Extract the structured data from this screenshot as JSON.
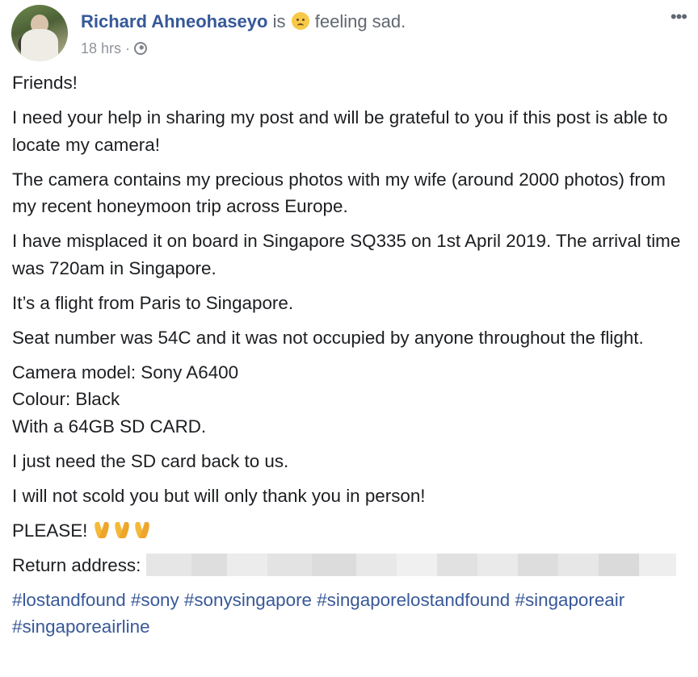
{
  "post": {
    "author": "Richard Ahneohaseyo",
    "is_word": "is",
    "feeling_emoji": "sad-face-emoji",
    "feeling_text": "feeling sad.",
    "time": "18 hrs",
    "separator": "·",
    "privacy_icon": "globe-icon",
    "more_icon": "•••",
    "paragraphs": [
      "Friends!",
      "I need your help in sharing my post and will be grateful to you if this post is able to locate my camera!",
      "The camera contains my precious photos with my wife (around 2000 photos) from my recent honeymoon trip across Europe.",
      "I have misplaced it on board in Singapore SQ335 on 1st April 2019. The arrival time was 720am in Singapore.",
      "It’s a flight from Paris to Singapore.",
      "Seat number was 54C and it was not occupied by anyone throughout the flight."
    ],
    "camera_model": "Camera model: Sony A6400",
    "colour": "Colour: Black",
    "sd_card": "With a 64GB SD CARD.",
    "sd_back": "I just need the SD card back to us.",
    "thanks": "I will not scold you but will only thank you in person!",
    "please": "PLEASE!",
    "please_emojis": [
      "praying-hands-emoji",
      "praying-hands-emoji",
      "praying-hands-emoji"
    ],
    "return_label": "Return address:",
    "hashtags": [
      "#lostandfound",
      "#sony",
      "#sonysingapore",
      "#singaporelostandfound",
      "#singaporeair",
      "#singaporeairline"
    ]
  },
  "colors": {
    "author_link": "#365899",
    "hashtag_link": "#385898",
    "meta_text": "#90949c",
    "body_text": "#1c1e21"
  }
}
